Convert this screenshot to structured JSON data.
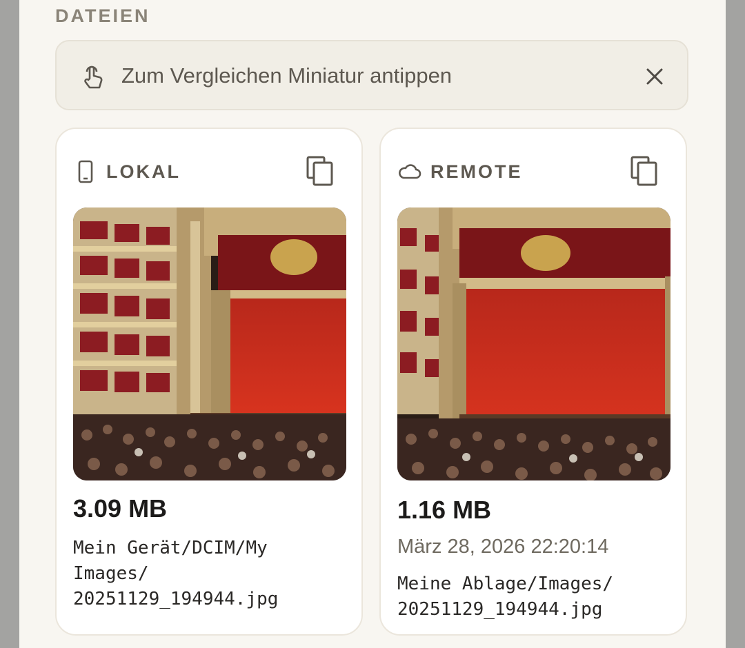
{
  "section": {
    "title": "DATEIEN"
  },
  "hint": {
    "text": "Zum Vergleichen Miniatur antippen",
    "icon": "touch-icon",
    "close_icon": "close-icon"
  },
  "local": {
    "label": "LOKAL",
    "icon": "phone-icon",
    "copy_icon": "copy-icon",
    "size": "3.09 MB",
    "path": "Mein Gerät/DCIM/My\nImages/\n20251129_194944.jpg"
  },
  "remote": {
    "label": "REMOTE",
    "icon": "cloud-icon",
    "copy_icon": "copy-icon",
    "size": "1.16 MB",
    "date": "März 28, 2026 22:20:14",
    "path": "Meine Ablage/Images/\n20251129_194944.jpg"
  },
  "colors": {
    "accent_text": "#5d5850",
    "curtain_red": "#c8291c",
    "card_bg": "#ffffff",
    "hint_bg": "#f1eee6"
  }
}
